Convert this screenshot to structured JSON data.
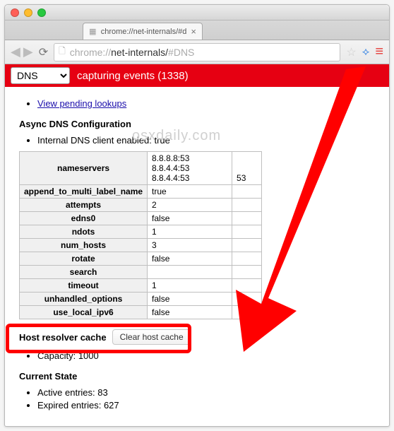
{
  "window": {
    "tab_title": "chrome://net-internals/#d"
  },
  "toolbar": {
    "url_scheme_host": "chrome://",
    "url_path": "net-internals/",
    "url_fragment": "#DNS"
  },
  "capture": {
    "dropdown_selected": "DNS",
    "status_text": "capturing events (1338)"
  },
  "links": {
    "pending": "View pending lookups"
  },
  "async_config": {
    "heading": "Async DNS Configuration",
    "client_enabled_label": "Internal DNS client enabled: ",
    "client_enabled_value": "true",
    "nameservers_label": "nameservers",
    "nameservers": [
      "8.8.8.8:53",
      "8.8.4.4:53",
      "8.8.4.4:53"
    ],
    "nameserver_extra": "53",
    "rows": [
      {
        "key": "append_to_multi_label_name",
        "val": "true"
      },
      {
        "key": "attempts",
        "val": "2"
      },
      {
        "key": "edns0",
        "val": "false"
      },
      {
        "key": "ndots",
        "val": "1"
      },
      {
        "key": "num_hosts",
        "val": "3"
      },
      {
        "key": "rotate",
        "val": "false"
      },
      {
        "key": "search",
        "val": ""
      },
      {
        "key": "timeout",
        "val": "1"
      },
      {
        "key": "unhandled_options",
        "val": "false"
      },
      {
        "key": "use_local_ipv6",
        "val": "false"
      }
    ]
  },
  "host_resolver": {
    "label": "Host resolver cache",
    "button": "Clear host cache",
    "capacity_label": "Capacity: ",
    "capacity": "1000"
  },
  "current_state": {
    "heading": "Current State",
    "active_label": "Active entries: ",
    "active": "83",
    "expired_label": "Expired entries: ",
    "expired": "627"
  },
  "watermark": "osxdaily.com"
}
